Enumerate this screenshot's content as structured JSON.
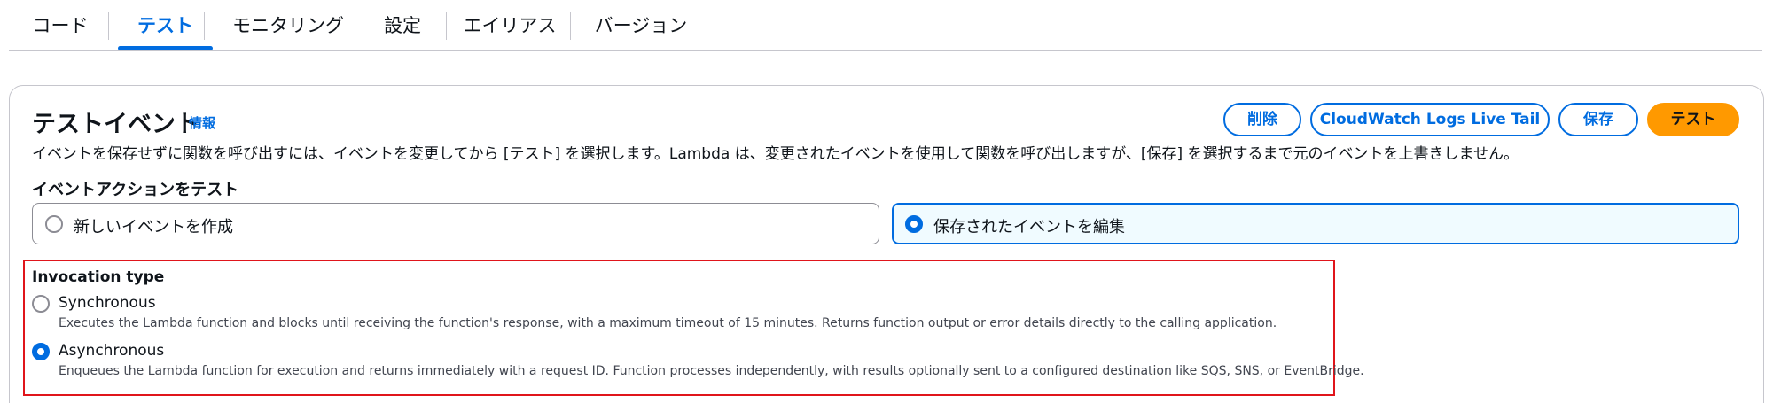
{
  "tabs": [
    {
      "label": "コード"
    },
    {
      "label": "テスト"
    },
    {
      "label": "モニタリング"
    },
    {
      "label": "設定"
    },
    {
      "label": "エイリアス"
    },
    {
      "label": "バージョン"
    }
  ],
  "active_tab": "テスト",
  "panel": {
    "title": "テストイベント",
    "info_link": "情報",
    "description": "イベントを保存せずに関数を呼び出すには、イベントを変更してから [テスト] を選択します。Lambda は、変更されたイベントを使用して関数を呼び出しますが、[保存] を選択するまで元のイベントを上書きしません。",
    "buttons": {
      "delete": "削除",
      "live_tail": "CloudWatch Logs Live Tail",
      "save": "保存",
      "test": "テスト"
    }
  },
  "event_action": {
    "label": "イベントアクションをテスト",
    "options": [
      {
        "label": "新しいイベントを作成",
        "selected": false
      },
      {
        "label": "保存されたイベントを編集",
        "selected": true
      }
    ]
  },
  "invocation": {
    "title": "Invocation type",
    "options": [
      {
        "label": "Synchronous",
        "description": "Executes the Lambda function and blocks until receiving the function's response, with a maximum timeout of 15 minutes. Returns function output or error details directly to the calling application.",
        "selected": false
      },
      {
        "label": "Asynchronous",
        "description": "Enqueues the Lambda function for execution and returns immediately with a request ID. Function processes independently, with results optionally sent to a configured destination like SQS, SNS, or EventBridge.",
        "selected": true
      }
    ]
  },
  "colors": {
    "accent": "#006ce0",
    "primary_button": "#ff9900",
    "highlight_box": "#e0151b",
    "selected_tile_bg": "#f0fbff"
  }
}
